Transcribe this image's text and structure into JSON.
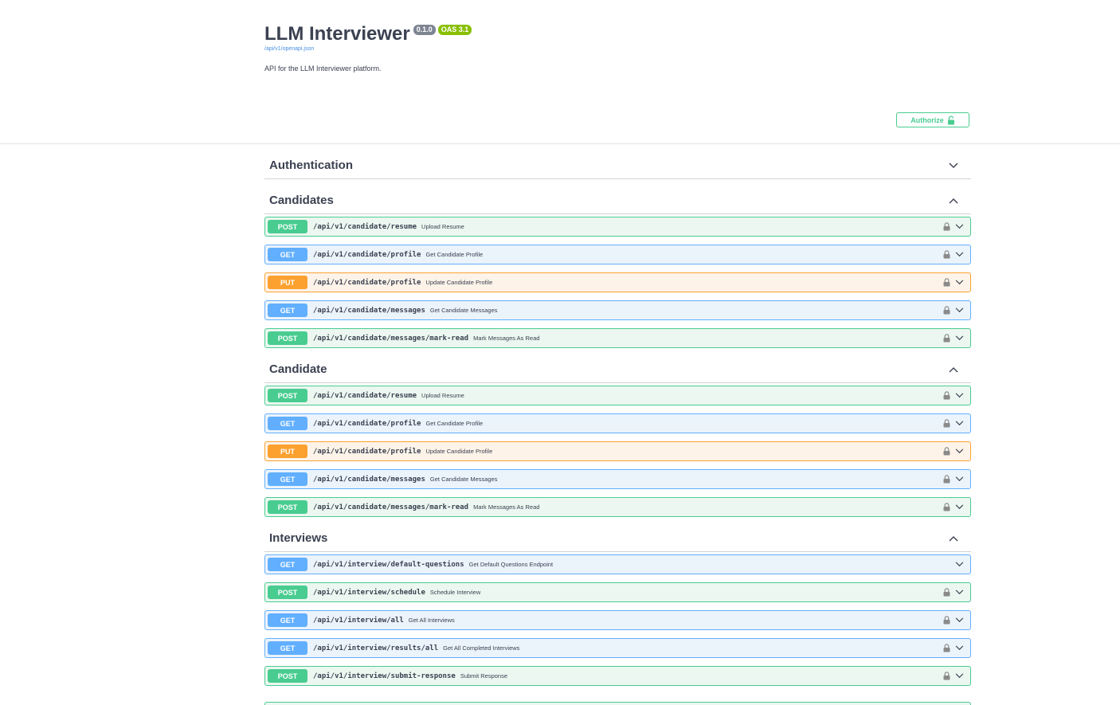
{
  "info": {
    "title": "LLM Interviewer",
    "version": "0.1.0",
    "oas": "OAS 3.1",
    "spec_link": "/api/v1/openapi.json",
    "description": "API for the LLM Interviewer platform."
  },
  "authorize": {
    "label": "Authorize",
    "icon": "unlock-icon"
  },
  "tags": [
    {
      "name": "Authentication",
      "expanded": false,
      "operations": []
    },
    {
      "name": "Candidates",
      "expanded": true,
      "operations": [
        {
          "method": "POST",
          "path": "/api/v1/candidate/resume",
          "summary": "Upload Resume",
          "locked": true
        },
        {
          "method": "GET",
          "path": "/api/v1/candidate/profile",
          "summary": "Get Candidate Profile",
          "locked": true
        },
        {
          "method": "PUT",
          "path": "/api/v1/candidate/profile",
          "summary": "Update Candidate Profile",
          "locked": true
        },
        {
          "method": "GET",
          "path": "/api/v1/candidate/messages",
          "summary": "Get Candidate Messages",
          "locked": true
        },
        {
          "method": "POST",
          "path": "/api/v1/candidate/messages/mark-read",
          "summary": "Mark Messages As Read",
          "locked": true
        }
      ]
    },
    {
      "name": "Candidate",
      "expanded": true,
      "operations": [
        {
          "method": "POST",
          "path": "/api/v1/candidate/resume",
          "summary": "Upload Resume",
          "locked": true
        },
        {
          "method": "GET",
          "path": "/api/v1/candidate/profile",
          "summary": "Get Candidate Profile",
          "locked": true
        },
        {
          "method": "PUT",
          "path": "/api/v1/candidate/profile",
          "summary": "Update Candidate Profile",
          "locked": true
        },
        {
          "method": "GET",
          "path": "/api/v1/candidate/messages",
          "summary": "Get Candidate Messages",
          "locked": true
        },
        {
          "method": "POST",
          "path": "/api/v1/candidate/messages/mark-read",
          "summary": "Mark Messages As Read",
          "locked": true
        }
      ]
    },
    {
      "name": "Interviews",
      "expanded": true,
      "operations": [
        {
          "method": "GET",
          "path": "/api/v1/interview/default-questions",
          "summary": "Get Default Questions Endpoint",
          "locked": false
        },
        {
          "method": "POST",
          "path": "/api/v1/interview/schedule",
          "summary": "Schedule Interview",
          "locked": true
        },
        {
          "method": "GET",
          "path": "/api/v1/interview/all",
          "summary": "Get All Interviews",
          "locked": true
        },
        {
          "method": "GET",
          "path": "/api/v1/interview/results/all",
          "summary": "Get All Completed Interviews",
          "locked": true
        },
        {
          "method": "POST",
          "path": "/api/v1/interview/submit-response",
          "summary": "Submit Response",
          "locked": true
        }
      ]
    }
  ],
  "colors": {
    "post": "#49cc90",
    "get": "#61affe",
    "put": "#fca130"
  }
}
